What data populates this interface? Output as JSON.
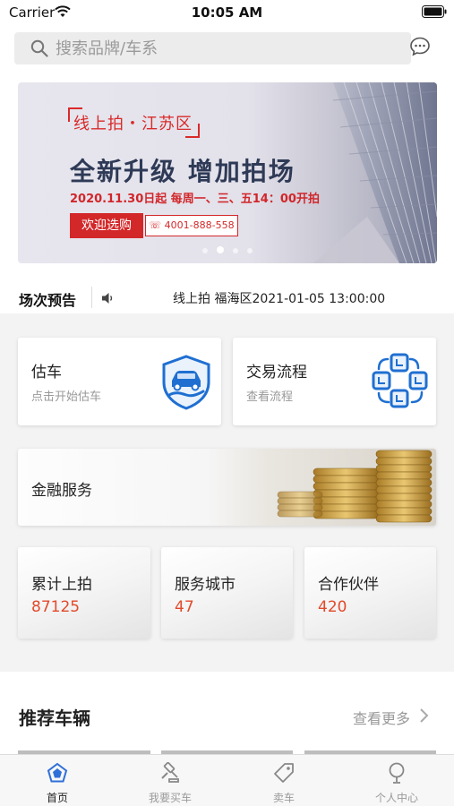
{
  "status_bar": {
    "carrier": "Carrier",
    "time": "10:05 AM"
  },
  "search": {
    "placeholder": "搜索品牌/车系"
  },
  "banner": {
    "tag": "线上拍・江苏区",
    "headline": "全新升级 增加拍场",
    "schedule": "2020.11.30日起 每周一、三、五14：00开拍",
    "cta": "欢迎选购",
    "phone": "☏ 4001-888-558",
    "slides": 4,
    "active_slide": 1
  },
  "notice": {
    "label": "场次预告",
    "text": "线上拍 福海区2021-01-05 13:00:00"
  },
  "services": [
    {
      "title": "估车",
      "subtitle": "点击开始估车",
      "icon": "car-shield-icon"
    },
    {
      "title": "交易流程",
      "subtitle": "查看流程",
      "icon": "process-flow-icon"
    }
  ],
  "finance": {
    "title": "金融服务",
    "icon": "coins-image"
  },
  "stats": [
    {
      "label": "累计上拍",
      "value": "87125"
    },
    {
      "label": "服务城市",
      "value": "47"
    },
    {
      "label": "合作伙伴",
      "value": "420"
    }
  ],
  "recommend": {
    "title": "推荐车辆",
    "more": "查看更多"
  },
  "tabs": [
    {
      "label": "首页",
      "icon": "home-pentagon-icon",
      "active": true
    },
    {
      "label": "我要买车",
      "icon": "auction-gavel-icon",
      "active": false
    },
    {
      "label": "卖车",
      "icon": "price-tag-icon",
      "active": false
    },
    {
      "label": "个人中心",
      "icon": "user-bulb-icon",
      "active": false
    }
  ],
  "colors": {
    "accent_red": "#d3282a",
    "stat_value": "#e24a2b",
    "icon_blue": "#1f6fd1"
  }
}
